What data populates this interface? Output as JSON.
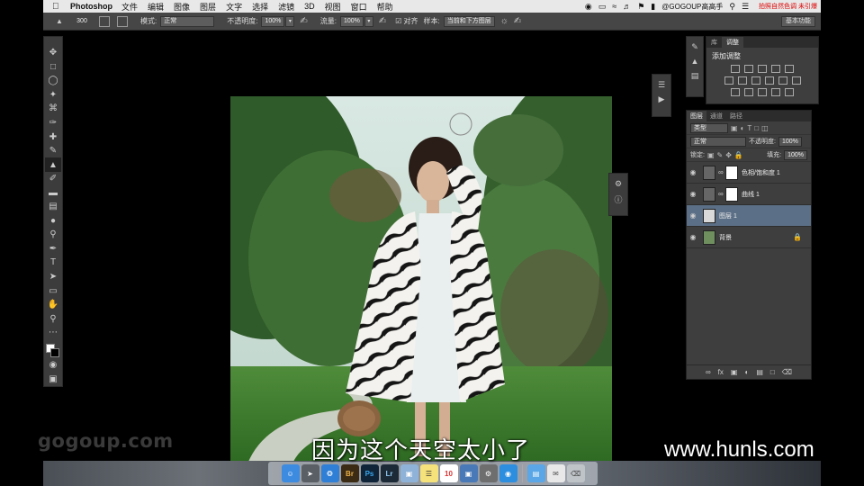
{
  "menubar": {
    "apple": "",
    "app_name": "Photoshop",
    "items": [
      "文件",
      "编辑",
      "图像",
      "图层",
      "文字",
      "选择",
      "滤镜",
      "3D",
      "视图",
      "窗口",
      "帮助"
    ],
    "user": "@GOGOUP高高手",
    "note": "拍照自然色调 未引爆"
  },
  "options": {
    "brush_size": "300",
    "mode_label": "模式:",
    "mode_value": "正常",
    "opacity_label": "不透明度:",
    "opacity_value": "100%",
    "flow_label": "流量:",
    "flow_value": "100%",
    "align_label": "对齐",
    "sample_label": "样本:",
    "sample_value": "当前和下方图层",
    "workspace_value": "基本功能"
  },
  "adjustments": {
    "tabs": [
      "库",
      "调整"
    ],
    "title": "添加调整"
  },
  "layers_panel": {
    "tabs": [
      "图层",
      "通道",
      "路径"
    ],
    "filter_value": "类型",
    "blend_value": "正常",
    "opacity_label": "不透明度:",
    "opacity_value": "100%",
    "lock_label": "锁定:",
    "fill_label": "填充:",
    "fill_value": "100%",
    "layers": [
      {
        "name": "色相/饱和度 1",
        "thumb_color": "#ffffff",
        "selected": false
      },
      {
        "name": "曲线 1",
        "thumb_color": "#ffffff",
        "selected": false
      },
      {
        "name": "图层 1",
        "thumb_color": "#d9d9d9",
        "selected": true
      },
      {
        "name": "背景",
        "thumb_color": "#6f8f5f",
        "selected": false
      }
    ]
  },
  "dock": {
    "items": [
      "finder",
      "launchpad",
      "safari",
      "Br",
      "Ps",
      "Lr",
      "preview",
      "notes",
      "calendar-10",
      "photos",
      "system-preferences",
      "qq",
      "folder",
      "mail",
      "trash"
    ]
  },
  "watermark_left": "gogoup.com",
  "watermark_right": "www.hunls.com",
  "subtitle": "因为这个天空太小了",
  "colors": {
    "panel_bg": "#3e3e3e",
    "selected_layer": "#5b6f86",
    "menubar_bg": "#e8e8e8"
  }
}
